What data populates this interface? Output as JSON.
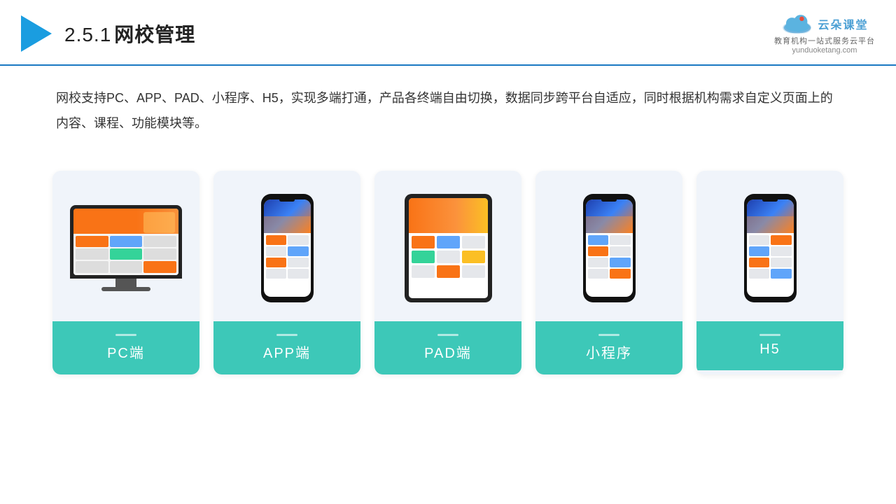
{
  "header": {
    "title": "网校管理",
    "section": "2.5.1",
    "logo_main": "云朵课堂",
    "logo_sub": "教育机构一站\n式服务云平台",
    "logo_url": "yunduoketang.com"
  },
  "description": "网校支持PC、APP、PAD、小程序、H5，实现多端打通，产品各终端自由切换，数据同步跨平台自适应，同时根据机构需求自定义页面上的内容、课程、功能模块等。",
  "cards": [
    {
      "id": "pc",
      "label": "PC端",
      "type": "pc"
    },
    {
      "id": "app",
      "label": "APP端",
      "type": "phone"
    },
    {
      "id": "pad",
      "label": "PAD端",
      "type": "tablet"
    },
    {
      "id": "miniprogram",
      "label": "小程序",
      "type": "phone"
    },
    {
      "id": "h5",
      "label": "H5",
      "type": "phone"
    }
  ],
  "colors": {
    "accent": "#3dc8b8",
    "header_border": "#1a78c2",
    "text_primary": "#222",
    "card_bg": "#f0f4fa"
  }
}
